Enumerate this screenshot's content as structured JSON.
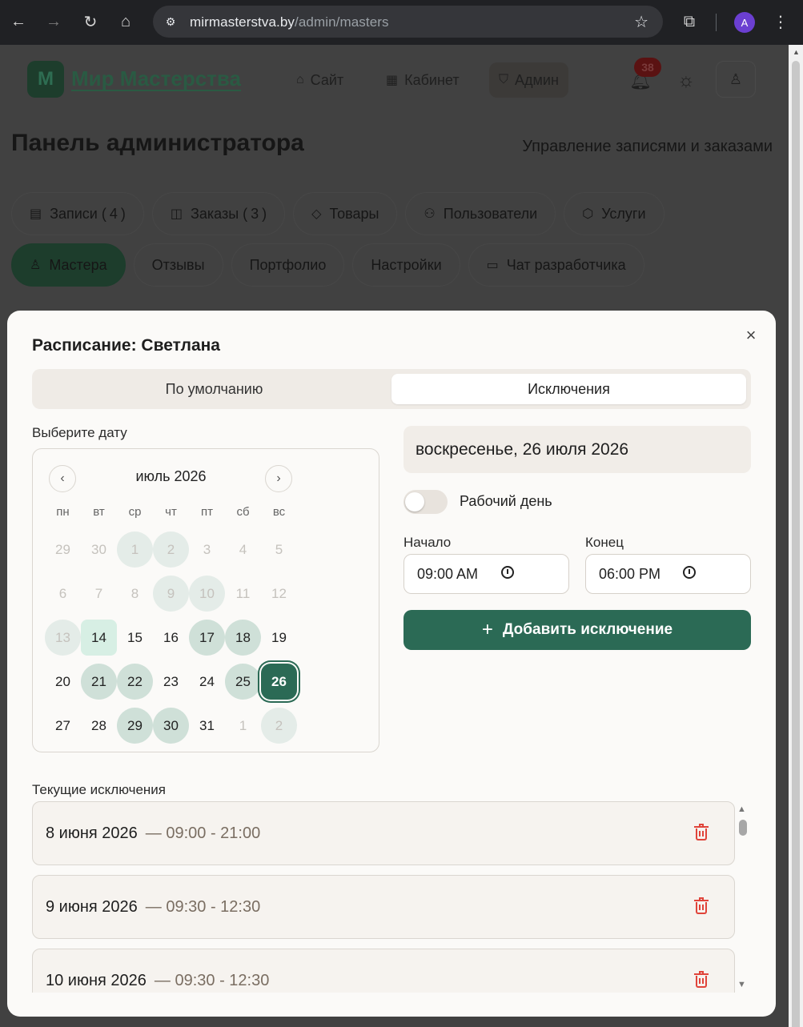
{
  "browser": {
    "url_host": "mirmasterstva.by",
    "url_path": "/admin/masters",
    "profile_initial": "A"
  },
  "header": {
    "logo_letter": "М",
    "logo_text": "Мир Мастерства",
    "nav": [
      {
        "label": "Сайт",
        "icon": "home-icon"
      },
      {
        "label": "Кабинет",
        "icon": "grid-icon"
      },
      {
        "label": "Админ",
        "icon": "shield-icon"
      }
    ],
    "notifications_count": "38"
  },
  "page": {
    "title": "Панель администратора",
    "subtitle": "Управление записями и заказами",
    "tabs_row1": [
      {
        "label": "Записи (",
        "count": "4",
        "close": ")",
        "icon": "calendar-icon"
      },
      {
        "label": "Заказы (",
        "count": "3",
        "close": ")",
        "icon": "bag-icon"
      },
      {
        "label": "Товары",
        "icon": "tag-icon"
      },
      {
        "label": "Пользователи",
        "icon": "users-icon"
      },
      {
        "label": "Услуги",
        "icon": "box-icon"
      }
    ],
    "tabs_row2": [
      {
        "label": "Мастера",
        "icon": "user-check-icon",
        "active": true
      },
      {
        "label": "Отзывы"
      },
      {
        "label": "Портфолио"
      },
      {
        "label": "Настройки"
      },
      {
        "label": "Чат разработчика",
        "icon": "chat-icon"
      }
    ]
  },
  "modal": {
    "title": "Расписание: Светлана",
    "segments": {
      "default": "По умолчанию",
      "exceptions": "Исключения",
      "active": "exceptions"
    },
    "choose_date_label": "Выберите дату",
    "calendar": {
      "month": "июль 2026",
      "weekdays": [
        "пн",
        "вт",
        "ср",
        "чт",
        "пт",
        "сб",
        "вс"
      ],
      "days": [
        {
          "n": "29",
          "s": "outside"
        },
        {
          "n": "30",
          "s": "outside"
        },
        {
          "n": "1",
          "s": "muted-ex"
        },
        {
          "n": "2",
          "s": "muted-ex"
        },
        {
          "n": "3",
          "s": "muted"
        },
        {
          "n": "4",
          "s": "muted"
        },
        {
          "n": "5",
          "s": "muted"
        },
        {
          "n": "6",
          "s": "muted"
        },
        {
          "n": "7",
          "s": "muted"
        },
        {
          "n": "8",
          "s": "muted"
        },
        {
          "n": "9",
          "s": "muted-ex"
        },
        {
          "n": "10",
          "s": "muted-ex"
        },
        {
          "n": "11",
          "s": "muted"
        },
        {
          "n": "12",
          "s": "muted"
        },
        {
          "n": "13",
          "s": "muted-ex"
        },
        {
          "n": "14",
          "s": "today"
        },
        {
          "n": "15",
          "s": ""
        },
        {
          "n": "16",
          "s": ""
        },
        {
          "n": "17",
          "s": "ex"
        },
        {
          "n": "18",
          "s": "ex"
        },
        {
          "n": "19",
          "s": ""
        },
        {
          "n": "20",
          "s": ""
        },
        {
          "n": "21",
          "s": "ex"
        },
        {
          "n": "22",
          "s": "ex"
        },
        {
          "n": "23",
          "s": ""
        },
        {
          "n": "24",
          "s": ""
        },
        {
          "n": "25",
          "s": "ex"
        },
        {
          "n": "26",
          "s": "selected"
        },
        {
          "n": "27",
          "s": ""
        },
        {
          "n": "28",
          "s": ""
        },
        {
          "n": "29",
          "s": "ex"
        },
        {
          "n": "30",
          "s": "ex"
        },
        {
          "n": "31",
          "s": ""
        },
        {
          "n": "1",
          "s": "outside"
        },
        {
          "n": "2",
          "s": "outside-ex"
        }
      ]
    },
    "selected_date": "воскресенье, 26 июля 2026",
    "working_day_label": "Рабочий день",
    "working_day": false,
    "start_label": "Начало",
    "end_label": "Конец",
    "start_value": "09:00 AM",
    "end_value": "06:00 PM",
    "add_button": "Добавить исключение",
    "current_label": "Текущие исключения",
    "exceptions": [
      {
        "date": "8 июня 2026",
        "time": "— 09:00 - 21:00"
      },
      {
        "date": "9 июня 2026",
        "time": "— 09:30 - 12:30"
      },
      {
        "date": "10 июня 2026",
        "time": "— 09:30 - 12:30"
      }
    ]
  },
  "colors": {
    "accent": "#2b6a55",
    "danger": "#e0443a",
    "exception_day": "#cfe0d8"
  }
}
